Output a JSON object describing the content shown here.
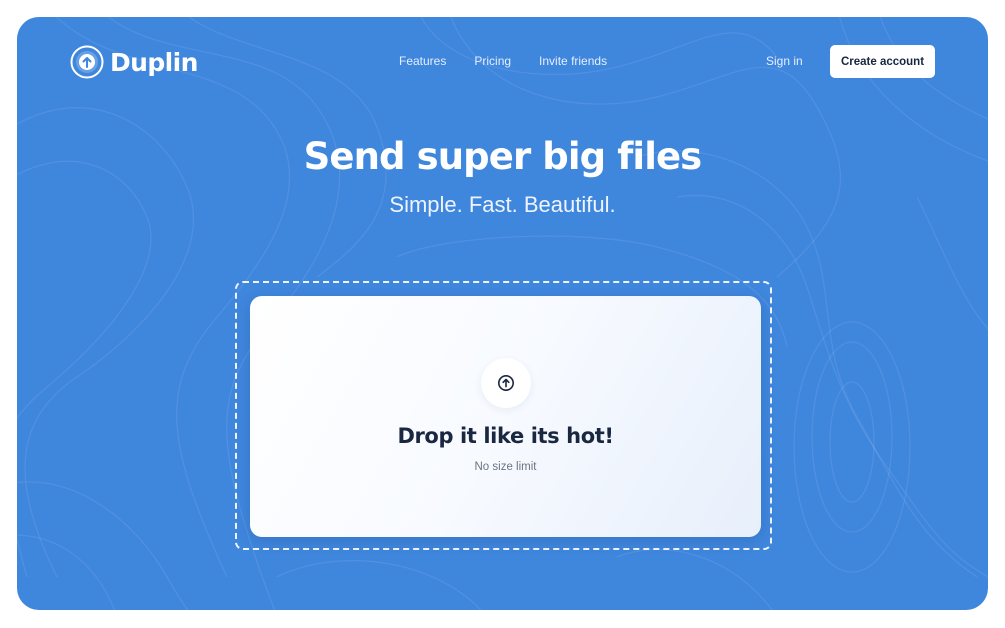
{
  "brand": {
    "name": "Duplin",
    "logo_icon": "upload-arrow-circle-icon"
  },
  "nav": {
    "items": [
      {
        "label": "Features"
      },
      {
        "label": "Pricing"
      },
      {
        "label": "Invite friends"
      }
    ],
    "sign_in": "Sign in",
    "create_account": "Create account"
  },
  "hero": {
    "title": "Send super big files",
    "subtitle": "Simple. Fast. Beautiful."
  },
  "dropzone": {
    "icon": "upload-arrow-icon",
    "title": "Drop it like its hot!",
    "note": "No size limit"
  },
  "colors": {
    "background": "#3f86dd",
    "card": "#ffffff",
    "text_dark": "#1a2740",
    "text_muted": "#6b7382"
  }
}
